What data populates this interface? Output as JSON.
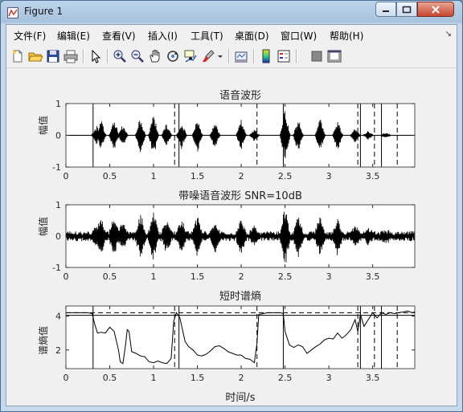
{
  "window": {
    "title": "Figure 1"
  },
  "menu": [
    "文件(F)",
    "编辑(E)",
    "查看(V)",
    "插入(I)",
    "工具(T)",
    "桌面(D)",
    "窗口(W)",
    "帮助(H)"
  ],
  "toolbar_icons": [
    "new-file-icon",
    "open-folder-icon",
    "save-icon",
    "print-icon",
    "pointer-icon",
    "zoom-in-icon",
    "zoom-out-icon",
    "pan-hand-icon",
    "rotate-3d-icon",
    "data-cursor-icon",
    "brush-icon",
    "brush-dropdown-icon",
    "link-plot-icon",
    "colorbar-icon",
    "legend-icon",
    "hide-plot-tools-icon",
    "show-plot-tools-icon"
  ],
  "colors": {
    "plot_line": "#000000",
    "axes_bg": "#ffffff",
    "figure_bg": "#f0f0f0"
  },
  "chart_data": [
    {
      "type": "line",
      "title": "语音波形",
      "xlabel": "",
      "ylabel": "幅值",
      "xlim": [
        0,
        3.98
      ],
      "ylim": [
        -1,
        1
      ],
      "xticks": [
        "0",
        "0.5",
        "1",
        "1.5",
        "2",
        "2.5",
        "3",
        "3.5"
      ],
      "yticks": [
        "-1",
        "0",
        "1"
      ],
      "segments_start": [
        0.31,
        1.29,
        2.48,
        3.36,
        3.6
      ],
      "segments_end": [
        1.24,
        2.18,
        3.33,
        3.52,
        3.78
      ],
      "description_envelope": [
        [
          0.35,
          0.3
        ],
        [
          0.4,
          0.5
        ],
        [
          0.55,
          0.55
        ],
        [
          0.65,
          0.35
        ],
        [
          0.85,
          0.6
        ],
        [
          1.0,
          0.72
        ],
        [
          1.15,
          0.4
        ],
        [
          1.32,
          0.45
        ],
        [
          1.5,
          0.55
        ],
        [
          1.7,
          0.45
        ],
        [
          2.0,
          0.5
        ],
        [
          2.15,
          0.2
        ],
        [
          2.5,
          0.85
        ],
        [
          2.65,
          0.55
        ],
        [
          2.9,
          0.55
        ],
        [
          3.1,
          0.5
        ],
        [
          3.3,
          0.25
        ],
        [
          3.45,
          0.15
        ],
        [
          3.65,
          0.1
        ]
      ]
    },
    {
      "type": "line",
      "title": "带噪语音波形 SNR=10dB",
      "xlabel": "",
      "ylabel": "幅值",
      "xlim": [
        0,
        3.98
      ],
      "ylim": [
        -1,
        1
      ],
      "xticks": [
        "0",
        "0.5",
        "1",
        "1.5",
        "2",
        "2.5",
        "3",
        "3.5"
      ],
      "yticks": [
        "-1",
        "0",
        "1"
      ]
    },
    {
      "type": "line",
      "title": "短时谱熵",
      "xlabel": "时间/s",
      "ylabel": "谱熵值",
      "xlim": [
        0,
        3.98
      ],
      "ylim": [
        0.9,
        4.6
      ],
      "xticks": [
        "0",
        "0.5",
        "1",
        "1.5",
        "2",
        "2.5",
        "3",
        "3.5"
      ],
      "yticks": [
        "2",
        "4"
      ],
      "threshold_dashed": 4.2,
      "threshold_solid": 4.05,
      "x": [
        0,
        0.05,
        0.1,
        0.15,
        0.2,
        0.25,
        0.3,
        0.33,
        0.36,
        0.4,
        0.45,
        0.5,
        0.55,
        0.6,
        0.62,
        0.65,
        0.68,
        0.7,
        0.72,
        0.75,
        0.8,
        0.85,
        0.9,
        0.95,
        1.0,
        1.05,
        1.1,
        1.15,
        1.2,
        1.23,
        1.26,
        1.3,
        1.33,
        1.36,
        1.4,
        1.45,
        1.5,
        1.55,
        1.6,
        1.65,
        1.7,
        1.75,
        1.8,
        1.85,
        1.9,
        1.95,
        2.0,
        2.05,
        2.1,
        2.15,
        2.18,
        2.2,
        2.25,
        2.3,
        2.35,
        2.4,
        2.45,
        2.48,
        2.5,
        2.55,
        2.6,
        2.65,
        2.7,
        2.75,
        2.8,
        2.85,
        2.9,
        2.95,
        3.0,
        3.05,
        3.1,
        3.15,
        3.2,
        3.25,
        3.3,
        3.33,
        3.36,
        3.4,
        3.45,
        3.5,
        3.55,
        3.6,
        3.65,
        3.7,
        3.75,
        3.8,
        3.85,
        3.9,
        3.95,
        3.98
      ],
      "y": [
        4.2,
        4.2,
        4.2,
        4.2,
        4.2,
        4.2,
        4.15,
        3.5,
        3.0,
        3.05,
        3.0,
        3.35,
        3.1,
        2.0,
        1.3,
        1.2,
        2.3,
        3.2,
        3.1,
        1.9,
        1.8,
        1.65,
        1.6,
        1.3,
        1.25,
        1.35,
        1.25,
        1.2,
        1.5,
        3.7,
        4.2,
        3.9,
        3.2,
        2.5,
        2.2,
        2.0,
        1.7,
        1.65,
        1.75,
        1.95,
        2.2,
        2.25,
        2.1,
        1.9,
        1.8,
        1.7,
        1.7,
        1.5,
        1.45,
        1.25,
        2.4,
        4.1,
        4.15,
        4.2,
        4.2,
        4.2,
        4.2,
        4.15,
        3.1,
        2.3,
        2.15,
        2.3,
        2.2,
        1.8,
        2.0,
        2.2,
        2.35,
        2.6,
        2.7,
        2.65,
        3.0,
        2.7,
        2.9,
        3.2,
        3.8,
        3.1,
        4.1,
        3.4,
        3.8,
        4.2,
        3.9,
        4.2,
        4.1,
        4.2,
        4.15,
        4.2,
        4.25,
        4.3,
        4.2,
        4.25
      ]
    }
  ]
}
